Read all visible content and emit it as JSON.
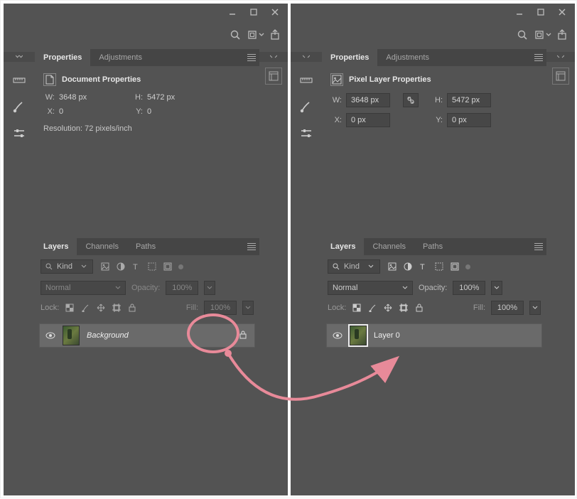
{
  "left": {
    "tabs": {
      "properties": "Properties",
      "adjustments": "Adjustments"
    },
    "props": {
      "title": "Document Properties",
      "w_label": "W:",
      "w_val": "3648 px",
      "h_label": "H:",
      "h_val": "5472 px",
      "x_label": "X:",
      "x_val": "0",
      "y_label": "Y:",
      "y_val": "0",
      "resolution": "Resolution: 72 pixels/inch"
    },
    "layers": {
      "tabs": {
        "layers": "Layers",
        "channels": "Channels",
        "paths": "Paths"
      },
      "kind": "Kind",
      "blend_mode": "Normal",
      "opacity_label": "Opacity:",
      "opacity_val": "100%",
      "lock_label": "Lock:",
      "fill_label": "Fill:",
      "fill_val": "100%",
      "layer_name": "Background"
    }
  },
  "right": {
    "tabs": {
      "properties": "Properties",
      "adjustments": "Adjustments"
    },
    "props": {
      "title": "Pixel Layer Properties",
      "w_label": "W:",
      "w_val": "3648 px",
      "h_label": "H:",
      "h_val": "5472 px",
      "x_label": "X:",
      "x_val": "0 px",
      "y_label": "Y:",
      "y_val": "0 px"
    },
    "layers": {
      "tabs": {
        "layers": "Layers",
        "channels": "Channels",
        "paths": "Paths"
      },
      "kind": "Kind",
      "blend_mode": "Normal",
      "opacity_label": "Opacity:",
      "opacity_val": "100%",
      "lock_label": "Lock:",
      "fill_label": "Fill:",
      "fill_val": "100%",
      "layer_name": "Layer 0"
    }
  }
}
